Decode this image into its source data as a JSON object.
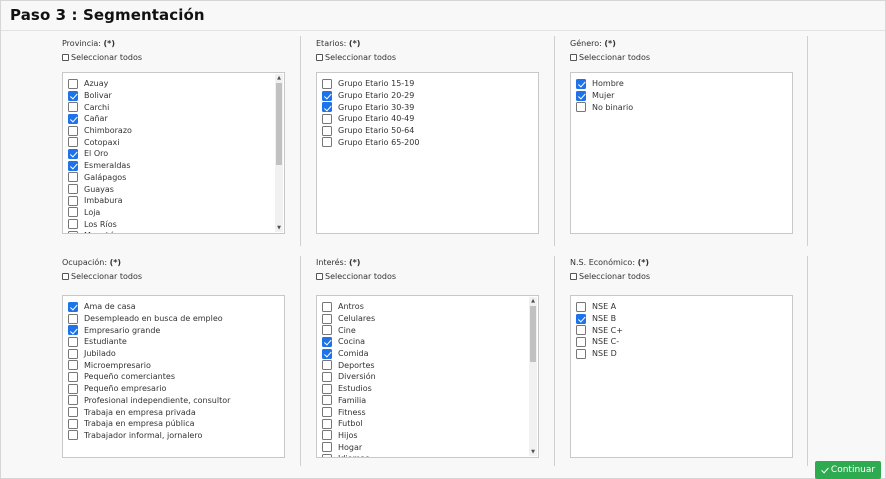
{
  "title": "Paso 3 : Segmentación",
  "select_all_label": "Seleccionar todos",
  "panels": {
    "provincia": {
      "label": "Provincia:",
      "required": "(*)",
      "items": [
        {
          "label": "Azuay",
          "checked": false
        },
        {
          "label": "Bolivar",
          "checked": true
        },
        {
          "label": "Carchi",
          "checked": false
        },
        {
          "label": "Cañar",
          "checked": true
        },
        {
          "label": "Chimborazo",
          "checked": false
        },
        {
          "label": "Cotopaxi",
          "checked": false
        },
        {
          "label": "El Oro",
          "checked": true
        },
        {
          "label": "Esmeraldas",
          "checked": true
        },
        {
          "label": "Galápagos",
          "checked": false
        },
        {
          "label": "Guayas",
          "checked": false
        },
        {
          "label": "Imbabura",
          "checked": false
        },
        {
          "label": "Loja",
          "checked": false
        },
        {
          "label": "Los Ríos",
          "checked": false
        },
        {
          "label": "Manabí",
          "checked": false
        }
      ]
    },
    "etarios": {
      "label": "Etarios:",
      "required": "(*)",
      "items": [
        {
          "label": "Grupo Etario 15-19",
          "checked": false
        },
        {
          "label": "Grupo Etario 20-29",
          "checked": true
        },
        {
          "label": "Grupo Etario 30-39",
          "checked": true
        },
        {
          "label": "Grupo Etario 40-49",
          "checked": false
        },
        {
          "label": "Grupo Etario 50-64",
          "checked": false
        },
        {
          "label": "Grupo Etario 65-200",
          "checked": false
        }
      ]
    },
    "genero": {
      "label": "Género:",
      "required": "(*)",
      "items": [
        {
          "label": "Hombre",
          "checked": true
        },
        {
          "label": "Mujer",
          "checked": true
        },
        {
          "label": "No binario",
          "checked": false
        }
      ]
    },
    "ocupacion": {
      "label": "Ocupación:",
      "required": "(*)",
      "items": [
        {
          "label": "Ama de casa",
          "checked": true
        },
        {
          "label": "Desempleado en busca de empleo",
          "checked": false
        },
        {
          "label": "Empresario grande",
          "checked": true
        },
        {
          "label": "Estudiante",
          "checked": false
        },
        {
          "label": "Jubilado",
          "checked": false
        },
        {
          "label": "Microempresario",
          "checked": false
        },
        {
          "label": "Pequeño comerciantes",
          "checked": false
        },
        {
          "label": "Pequeño empresario",
          "checked": false
        },
        {
          "label": "Profesional independiente, consultor",
          "checked": false
        },
        {
          "label": "Trabaja en empresa privada",
          "checked": false
        },
        {
          "label": "Trabaja en empresa pública",
          "checked": false
        },
        {
          "label": "Trabajador informal, jornalero",
          "checked": false
        }
      ]
    },
    "interes": {
      "label": "Interés:",
      "required": "(*)",
      "items": [
        {
          "label": "Antros",
          "checked": false
        },
        {
          "label": "Celulares",
          "checked": false
        },
        {
          "label": "Cine",
          "checked": false
        },
        {
          "label": "Cocina",
          "checked": true
        },
        {
          "label": "Comida",
          "checked": true
        },
        {
          "label": "Deportes",
          "checked": false
        },
        {
          "label": "Diversión",
          "checked": false
        },
        {
          "label": "Estudios",
          "checked": false
        },
        {
          "label": "Familia",
          "checked": false
        },
        {
          "label": "Fitness",
          "checked": false
        },
        {
          "label": "Futbol",
          "checked": false
        },
        {
          "label": "Hijos",
          "checked": false
        },
        {
          "label": "Hogar",
          "checked": false
        },
        {
          "label": "Idiomas",
          "checked": false
        }
      ]
    },
    "nse": {
      "label": "N.S. Económico:",
      "required": "(*)",
      "items": [
        {
          "label": "NSE A",
          "checked": false
        },
        {
          "label": "NSE B",
          "checked": true
        },
        {
          "label": "NSE C+",
          "checked": false
        },
        {
          "label": "NSE C-",
          "checked": false
        },
        {
          "label": "NSE D",
          "checked": false
        }
      ]
    }
  },
  "continue_label": "Continuar"
}
